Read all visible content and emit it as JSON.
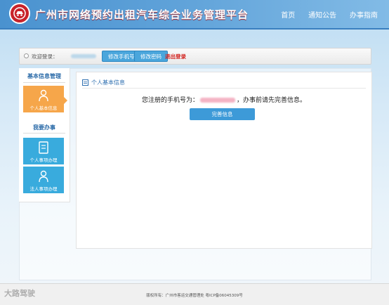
{
  "header": {
    "title": "广州市网络预约出租汽车综合业务管理平台",
    "nav": [
      "首页",
      "通知公告",
      "办事指南"
    ]
  },
  "userbar": {
    "welcome": "欢迎登录：",
    "change_phone": "修改手机号",
    "change_password": "修改密码",
    "logout": "退出登录"
  },
  "sidebar": {
    "section1_title": "基本信息管理",
    "personal_info": "个人基本信息",
    "section2_title": "我要办事",
    "personal_business": "个人事项办理",
    "corporate_business": "法人事项办理"
  },
  "content": {
    "title": "个人基本信息",
    "notice_prefix": "您注册的手机号为：",
    "notice_suffix": "，办事前请先完善信息。",
    "complete_button": "完善信息"
  },
  "footer": {
    "copyright": "版权所有：广州市客运交通管理处  粤ICP备06045309号"
  },
  "watermark": "大路驾驶",
  "colors": {
    "header": "#5a9fd8",
    "accent_blue": "#3d9ad8",
    "tile_orange": "#f6a64a",
    "tile_blue": "#39abdd",
    "logout_red": "#d2201c",
    "logo_red": "#c8222a"
  }
}
